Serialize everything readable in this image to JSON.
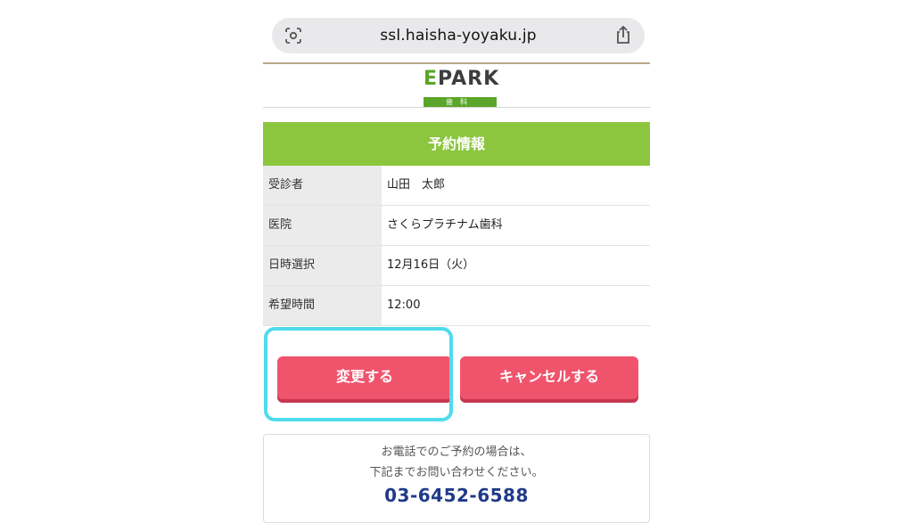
{
  "browser": {
    "url": "ssl.haisha-yoyaku.jp",
    "left_icon": "visual-lookup-icon",
    "right_icon": "share-icon"
  },
  "header": {
    "logo_text": "PARK",
    "logo_e": "E",
    "logo_sub": "歯科"
  },
  "section": {
    "title": "予約情報"
  },
  "info": {
    "rows": [
      {
        "label": "受診者",
        "value": "山田　太郎"
      },
      {
        "label": "医院",
        "value": "さくらプラチナム歯科"
      },
      {
        "label": "日時選択",
        "value": "12月16日（火）"
      },
      {
        "label": "希望時間",
        "value": "12:00"
      }
    ]
  },
  "actions": {
    "change_label": "変更する",
    "cancel_label": "キャンセルする"
  },
  "contact": {
    "line1": "お電話でのご予約の場合は、",
    "line2": "下記までお問い合わせください。",
    "phone": "03-6452-6588"
  },
  "colors": {
    "accent_green": "#8cc63f",
    "button_pink": "#f0546d",
    "highlight_cyan": "#4fdbec",
    "phone_blue": "#1f3a8a"
  }
}
